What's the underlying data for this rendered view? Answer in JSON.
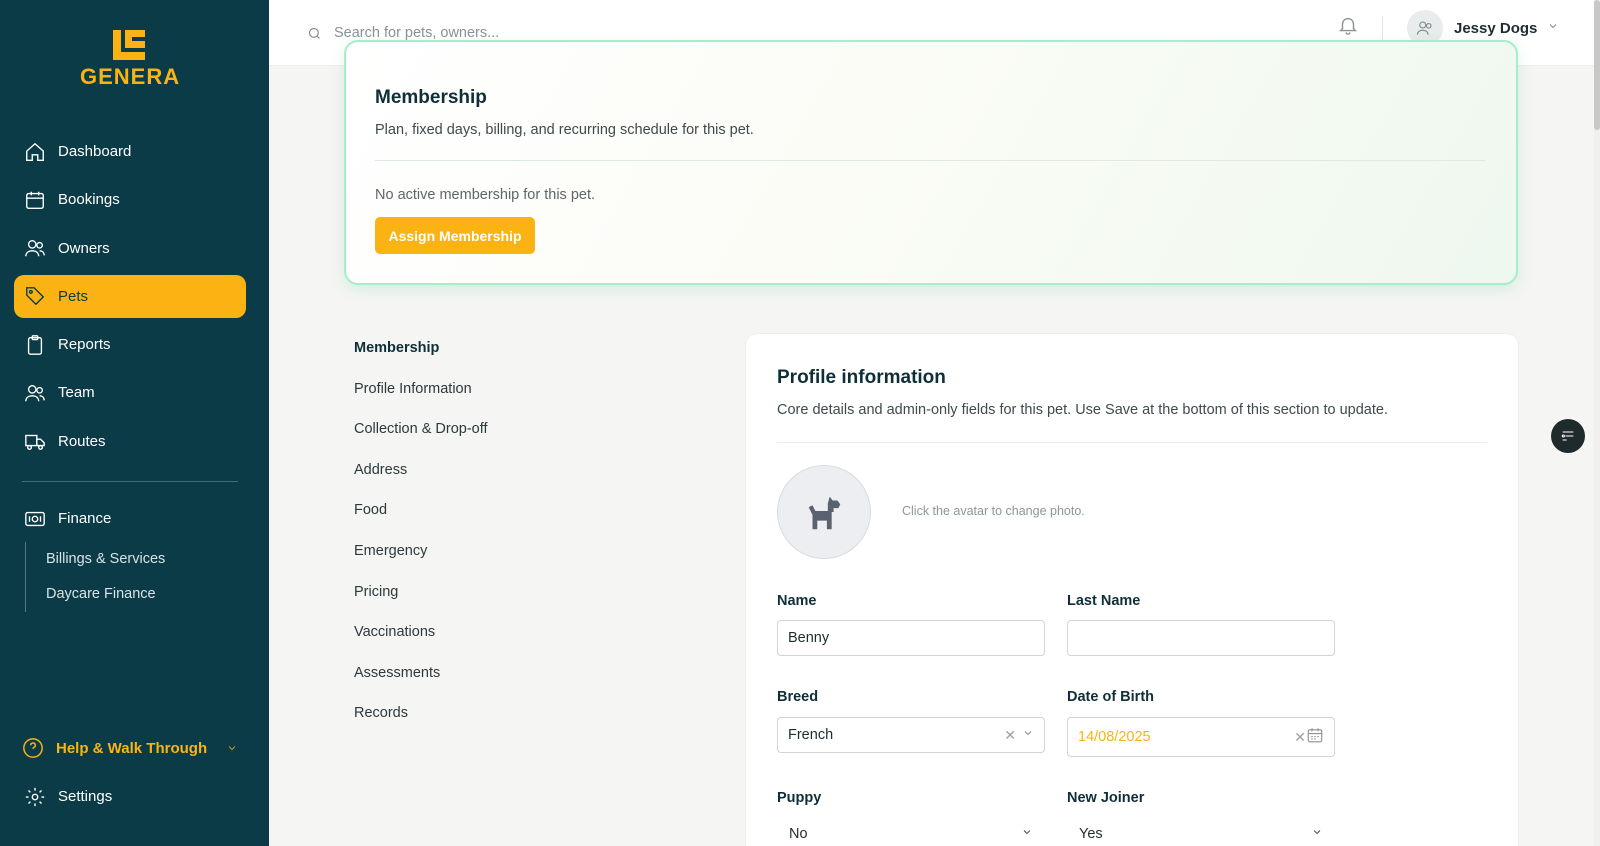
{
  "brand": {
    "name": "GENERA",
    "accent": "#fbb314",
    "sidebar_bg": "#0b3b47"
  },
  "sidebar": {
    "items": [
      {
        "label": "Dashboard",
        "icon": "home-icon"
      },
      {
        "label": "Bookings",
        "icon": "calendar-icon"
      },
      {
        "label": "Owners",
        "icon": "users-icon"
      },
      {
        "label": "Pets",
        "icon": "tag-icon",
        "active": true
      },
      {
        "label": "Reports",
        "icon": "clipboard-icon"
      },
      {
        "label": "Team",
        "icon": "team-icon"
      },
      {
        "label": "Routes",
        "icon": "truck-icon"
      }
    ],
    "finance": {
      "label": "Finance",
      "icon": "money-icon",
      "children": [
        "Billings & Services",
        "Daycare Finance"
      ]
    },
    "help": {
      "label": "Help & Walk Through",
      "icon": "help-circle-icon"
    },
    "settings": {
      "label": "Settings",
      "icon": "gear-icon"
    }
  },
  "topbar": {
    "search_placeholder": "Search for pets, owners...",
    "user_name": "Jessy Dogs"
  },
  "membership": {
    "title": "Membership",
    "description": "Plan, fixed days, billing, and recurring schedule for this pet.",
    "empty_text": "No active membership for this pet.",
    "button": "Assign Membership"
  },
  "section_nav": [
    "Membership",
    "Profile Information",
    "Collection & Drop-off",
    "Address",
    "Food",
    "Emergency",
    "Pricing",
    "Vaccinations",
    "Assessments",
    "Records"
  ],
  "profile": {
    "title": "Profile information",
    "description": "Core details and admin-only fields for this pet. Use Save at the bottom of this section to update.",
    "photo_hint": "Click the avatar to change photo.",
    "fields": {
      "name": {
        "label": "Name",
        "value": "Benny"
      },
      "last_name": {
        "label": "Last Name",
        "value": ""
      },
      "breed": {
        "label": "Breed",
        "value": "French"
      },
      "dob": {
        "label": "Date of Birth",
        "value": "14/08/2025"
      },
      "puppy": {
        "label": "Puppy",
        "value": "No"
      },
      "new_joiner": {
        "label": "New Joiner",
        "value": "Yes"
      }
    }
  }
}
